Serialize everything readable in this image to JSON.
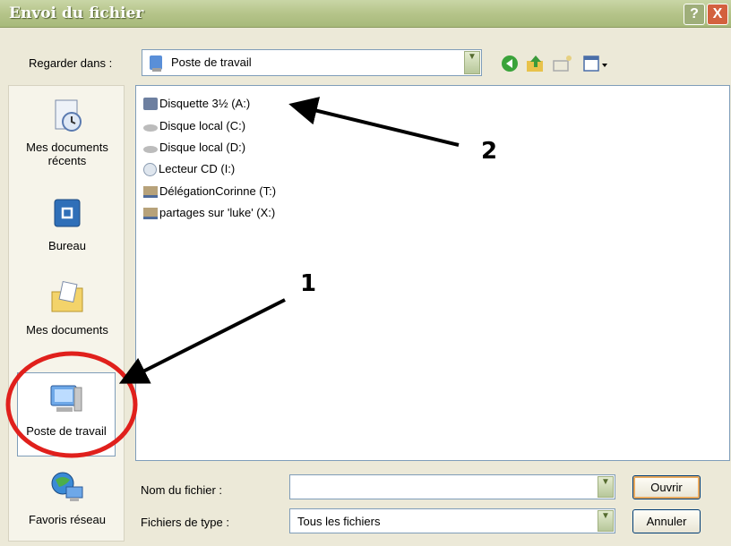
{
  "window": {
    "title": "Envoi du fichier",
    "help_glyph": "?",
    "close_glyph": "X"
  },
  "lookin": {
    "label": "Regarder dans :",
    "value": "Poste de travail"
  },
  "places": [
    {
      "label1": "Mes documents",
      "label2": "récents"
    },
    {
      "label1": "Bureau",
      "label2": ""
    },
    {
      "label1": "Mes documents",
      "label2": ""
    },
    {
      "label1": "Poste de travail",
      "label2": ""
    },
    {
      "label1": "Favoris réseau",
      "label2": ""
    }
  ],
  "files": [
    "Disquette 3½ (A:)",
    "Disque local (C:)",
    "Disque local (D:)",
    "Lecteur CD (I:)",
    "DélégationCorinne (T:)",
    "partages sur 'luke' (X:)"
  ],
  "filename": {
    "label": "Nom du fichier :",
    "value": ""
  },
  "filetype": {
    "label": "Fichiers de type :",
    "value": "Tous les fichiers"
  },
  "buttons": {
    "open": "Ouvrir",
    "cancel": "Annuler"
  },
  "annotations": {
    "one": "1",
    "two": "2"
  },
  "colors": {
    "highlight_circle": "#e0201c",
    "arrow": "#000000"
  }
}
